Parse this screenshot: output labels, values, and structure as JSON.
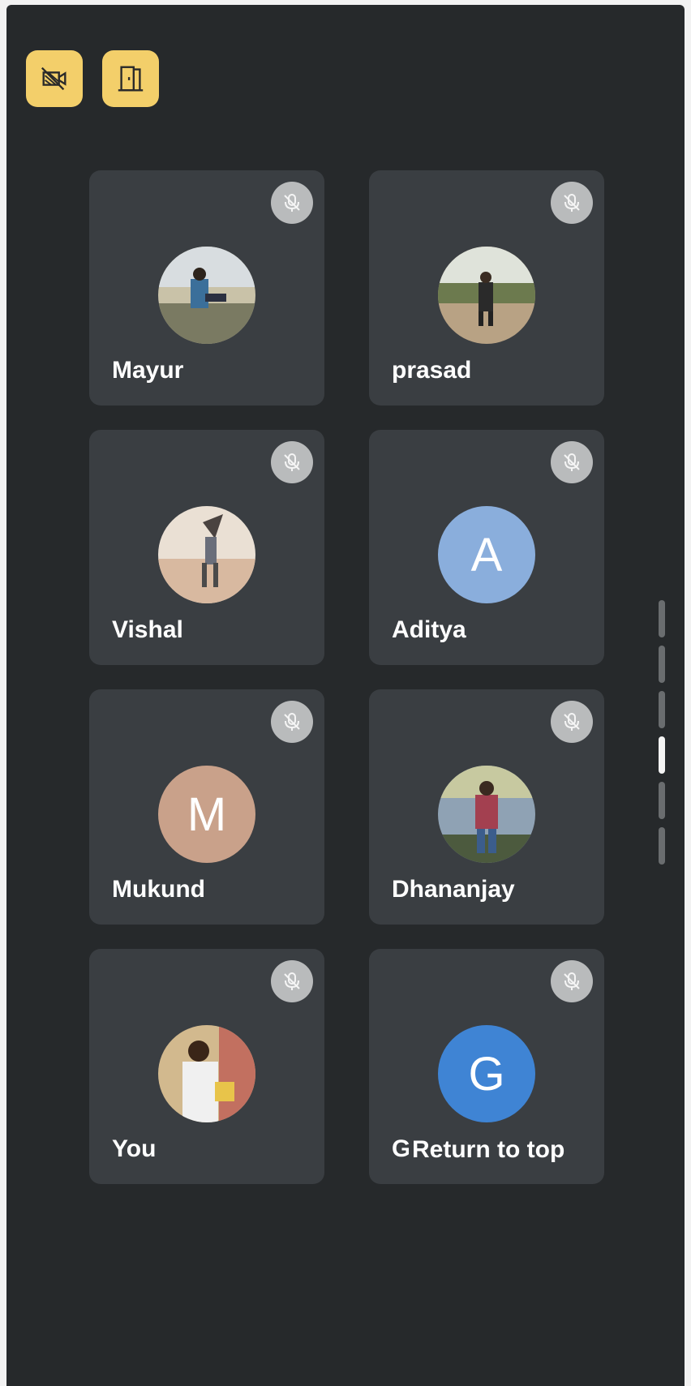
{
  "toolbar": {
    "camera_icon": "camera-off-icon",
    "exit_icon": "exit-door-icon",
    "accent": "#f3cf6a"
  },
  "participants": [
    {
      "name": "Mayur",
      "avatar": "photo",
      "muted": true
    },
    {
      "name": "prasad",
      "avatar": "photo",
      "muted": true
    },
    {
      "name": "Vishal",
      "avatar": "photo",
      "muted": true
    },
    {
      "name": "Aditya",
      "avatar": "letter",
      "letter": "A",
      "color": "#8aaedc",
      "muted": true
    },
    {
      "name": "Mukund",
      "avatar": "letter",
      "letter": "M",
      "color": "#c9a18a",
      "muted": true
    },
    {
      "name": "Dhananjay",
      "avatar": "photo",
      "muted": true
    },
    {
      "name": "You",
      "avatar": "photo",
      "muted": true
    },
    {
      "name": "G",
      "avatar": "letter",
      "letter": "G",
      "color": "#3f84d4",
      "muted": true
    }
  ],
  "return_to_top": "Return to top"
}
